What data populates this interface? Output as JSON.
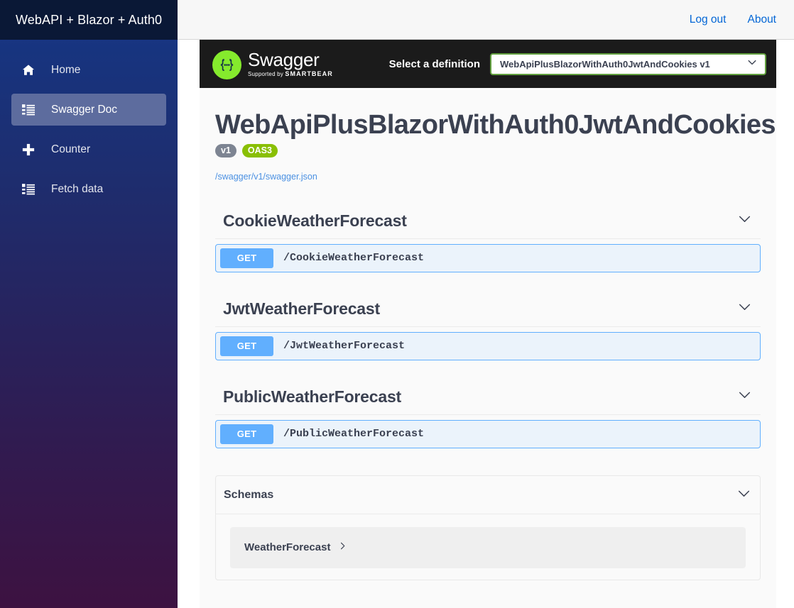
{
  "sidebar": {
    "brand_title": "WebAPI + Blazor + Auth0",
    "items": [
      {
        "label": "Home",
        "icon": "home-icon",
        "active": false
      },
      {
        "label": "Swagger Doc",
        "icon": "list-icon",
        "active": true
      },
      {
        "label": "Counter",
        "icon": "plus-icon",
        "active": false
      },
      {
        "label": "Fetch data",
        "icon": "list-icon",
        "active": false
      }
    ]
  },
  "topbar": {
    "logout_label": "Log out",
    "about_label": "About"
  },
  "swagger": {
    "wordmark": "Swagger",
    "supported_prefix": "Supported by ",
    "supported_brand": "SMARTBEAR",
    "select_label": "Select a definition",
    "selected_definition": "WebApiPlusBlazorWithAuth0JwtAndCookies v1",
    "title": "WebApiPlusBlazorWithAuth0JwtAndCookies",
    "badge_version": "v1",
    "badge_oas": "OAS3",
    "spec_url": "/swagger/v1/swagger.json",
    "tags": [
      {
        "name": "CookieWeatherForecast",
        "operations": [
          {
            "method": "GET",
            "path": "/CookieWeatherForecast"
          }
        ]
      },
      {
        "name": "JwtWeatherForecast",
        "operations": [
          {
            "method": "GET",
            "path": "/JwtWeatherForecast"
          }
        ]
      },
      {
        "name": "PublicWeatherForecast",
        "operations": [
          {
            "method": "GET",
            "path": "/PublicWeatherForecast"
          }
        ]
      }
    ],
    "models": {
      "title": "Schemas",
      "items": [
        {
          "name": "WeatherForecast"
        }
      ]
    }
  },
  "colors": {
    "method_get": "#61affe",
    "oas_badge": "#89bf04",
    "version_badge": "#7d8492",
    "swagger_green": "#85ea2d",
    "link_blue": "#4a90e2",
    "nav_link": "#0366d6"
  }
}
